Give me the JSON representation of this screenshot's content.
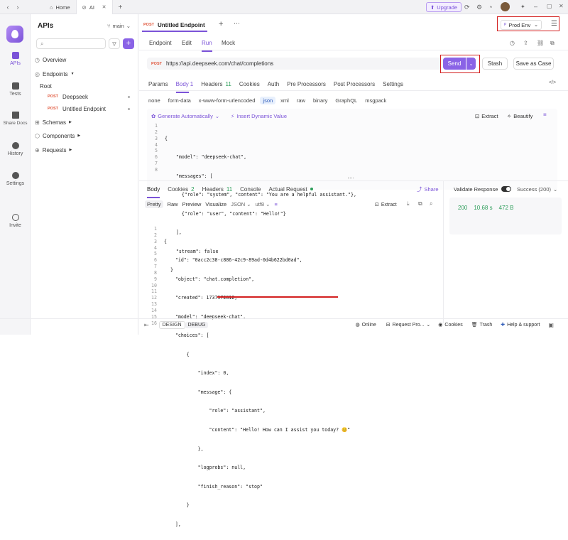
{
  "titlebar": {
    "tabs": [
      {
        "label": "Home"
      },
      {
        "label": "AI"
      }
    ],
    "upgrade_label": "Upgrade"
  },
  "rail": {
    "items": [
      {
        "label": "APIs"
      },
      {
        "label": "Tests"
      },
      {
        "label": "Share Docs"
      },
      {
        "label": "History"
      },
      {
        "label": "Settings"
      },
      {
        "label": "Invite"
      }
    ]
  },
  "sidebar": {
    "title": "APIs",
    "branch": "main",
    "overview": "Overview",
    "endpoints": "Endpoints",
    "root": "Root",
    "method": "POST",
    "endpoint_items": [
      {
        "label": "Deepseek"
      },
      {
        "label": "Untitled Endpoint"
      }
    ],
    "schemas": "Schemas",
    "components": "Components",
    "requests": "Requests"
  },
  "header": {
    "method": "POST",
    "doc_tab": "Untitled Endpoint",
    "env": "Prod Env"
  },
  "subtabs": [
    "Endpoint",
    "Edit",
    "Run",
    "Mock"
  ],
  "request": {
    "method": "POST",
    "url": "https://api.deepseek.com/chat/completions",
    "send": "Send",
    "stash": "Stash",
    "save_as_case": "Save as Case"
  },
  "req_tabs": [
    {
      "label": "Params",
      "count": ""
    },
    {
      "label": "Body",
      "count": "1"
    },
    {
      "label": "Headers",
      "count": "11"
    },
    {
      "label": "Cookies",
      "count": ""
    },
    {
      "label": "Auth",
      "count": ""
    },
    {
      "label": "Pre Processors",
      "count": ""
    },
    {
      "label": "Post Processors",
      "count": ""
    },
    {
      "label": "Settings",
      "count": ""
    }
  ],
  "body_types": [
    "none",
    "form-data",
    "x-www-form-urlencoded",
    "json",
    "xml",
    "raw",
    "binary",
    "GraphQL",
    "msgpack"
  ],
  "body_actions": {
    "generate": "Generate Automatically",
    "insert": "Insert Dynamic Value",
    "extract": "Extract",
    "beautify": "Beautify"
  },
  "request_body_lines": [
    "{",
    "    \"model\": \"deepseek-chat\",",
    "    \"messages\": [",
    "      {\"role\": \"system\", \"content\": \"You are a helpful assistant.\"},",
    "      {\"role\": \"user\", \"content\": \"Hello!\"}",
    "    ],",
    "    \"stream\": false",
    "  }"
  ],
  "resp_tabs": [
    {
      "label": "Body",
      "count": ""
    },
    {
      "label": "Cookies",
      "count": "2"
    },
    {
      "label": "Headers",
      "count": "11"
    },
    {
      "label": "Console",
      "count": ""
    },
    {
      "label": "Actual Request",
      "count": ""
    }
  ],
  "share": "Share",
  "resp_formats": [
    "Pretty",
    "Raw",
    "Preview",
    "Visualize",
    "JSON",
    "utf8"
  ],
  "resp_extract": "Extract",
  "validate": {
    "label": "Validate Response",
    "status": "Success (200)",
    "code": "200",
    "time": "10.68 s",
    "size": "472 B"
  },
  "response_lines": [
    "{",
    "    \"id\": \"0acc2c38-c886-42c9-89ad-0d4b622bd0ad\",",
    "    \"object\": \"chat.completion\",",
    "    \"created\": 1737972812,",
    "    \"model\": \"deepseek-chat\",",
    "    \"choices\": [",
    "        {",
    "            \"index\": 0,",
    "            \"message\": {",
    "                \"role\": \"assistant\",",
    "                \"content\": \"Hello! How can I assist you today? 😊\"",
    "            },",
    "            \"logprobs\": null,",
    "            \"finish_reason\": \"stop\"",
    "        }",
    "    ],"
  ],
  "footer": {
    "design": "DESIGN",
    "debug": "DEBUG",
    "online": "Online",
    "request_pro": "Request Pro...",
    "cookies": "Cookies",
    "trash": "Trash",
    "help": "Help & support"
  },
  "colors": {
    "accent": "#7b53d8",
    "send": "#8a63e6",
    "post": "#e0553a",
    "highlight": "#d32020"
  }
}
